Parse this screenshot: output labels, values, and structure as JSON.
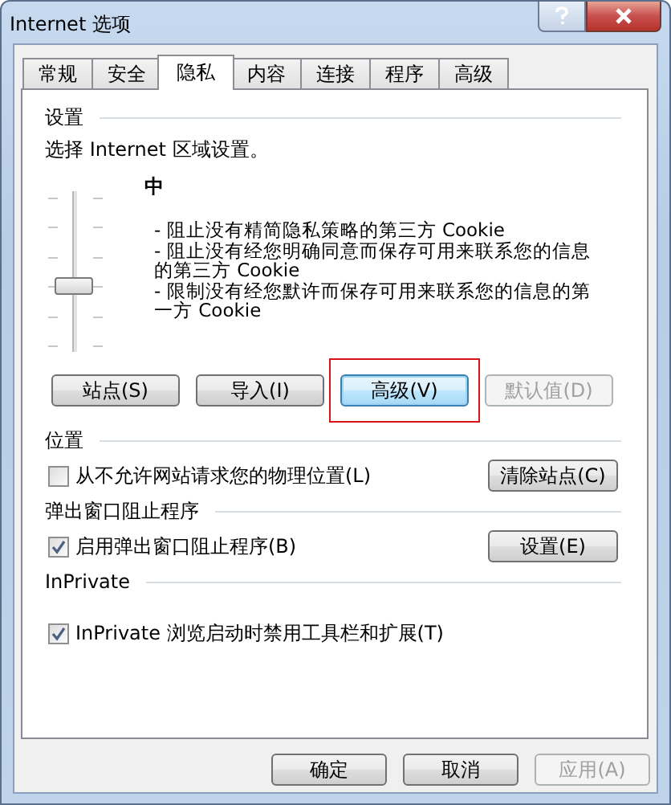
{
  "window": {
    "title": "Internet 选项"
  },
  "tabs": [
    {
      "label": "常规",
      "selected": false
    },
    {
      "label": "安全",
      "selected": false
    },
    {
      "label": "隐私",
      "selected": true
    },
    {
      "label": "内容",
      "selected": false
    },
    {
      "label": "连接",
      "selected": false
    },
    {
      "label": "程序",
      "selected": false
    },
    {
      "label": "高级",
      "selected": false
    }
  ],
  "settings": {
    "heading": "设置",
    "prompt": "选择 Internet 区域设置。",
    "level_name": "中",
    "slider": {
      "level": 0.4
    },
    "description": [
      "- 阻止没有精简隐私策略的第三方 Cookie",
      "- 阻止没有经您明确同意而保存可用来联系您的信息的第三方 Cookie",
      "- 限制没有经您默许而保存可用来联系您的信息的第一方 Cookie"
    ],
    "buttons": [
      {
        "label": "站点(S)",
        "disabled": false,
        "focused": false,
        "highlighted": false
      },
      {
        "label": "导入(I)",
        "disabled": false,
        "focused": false,
        "highlighted": false
      },
      {
        "label": "高级(V)",
        "disabled": false,
        "focused": true,
        "highlighted": true
      },
      {
        "label": "默认值(D)",
        "disabled": true,
        "focused": false,
        "highlighted": false
      }
    ]
  },
  "location": {
    "heading": "位置",
    "checkbox": {
      "label": "从不允许网站请求您的物理位置(L)",
      "checked": false
    },
    "button": "清除站点(C)"
  },
  "popup_blocker": {
    "heading": "弹出窗口阻止程序",
    "checkbox": {
      "label": "启用弹出窗口阻止程序(B)",
      "checked": true
    },
    "button": "设置(E)"
  },
  "inprivate": {
    "heading": "InPrivate",
    "checkbox": {
      "label": "InPrivate 浏览启动时禁用工具栏和扩展(T)",
      "checked": true
    }
  },
  "footer_buttons": [
    {
      "label": "确定",
      "disabled": false
    },
    {
      "label": "取消",
      "disabled": false
    },
    {
      "label": "应用(A)",
      "disabled": true
    }
  ]
}
